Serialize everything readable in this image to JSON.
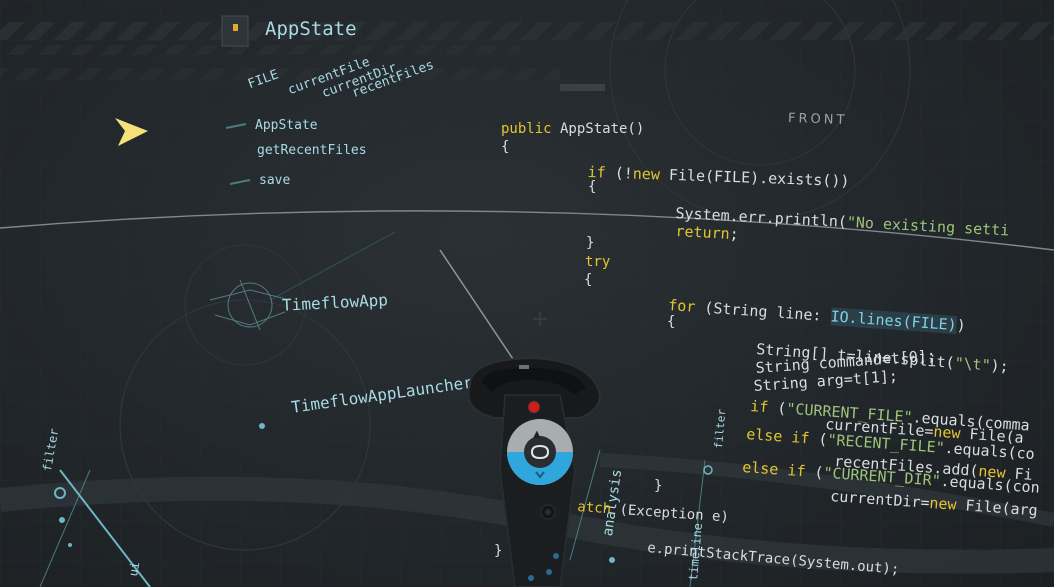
{
  "appstate_node": {
    "title": "AppState",
    "fields": [
      "FILE",
      "currentFile",
      "currentDir",
      "recentFiles"
    ],
    "methods": [
      "AppState",
      "getRecentFiles",
      "save"
    ]
  },
  "front_label": "FRONT",
  "classes": {
    "timeflow_app": "TimeflowApp",
    "timeflow_app_launcher": "TimeflowAppLauncher"
  },
  "floor_labels": {
    "filter_left": "filter",
    "filter_right": "filter",
    "analysis": "analysis",
    "ui": "ui",
    "timeline": "timeline"
  },
  "code": {
    "l1_kw": "public",
    "l1_rest": " AppState()",
    "l2": "{",
    "l3_kw": "if",
    "l3_mid": " (!",
    "l3_kw2": "new",
    "l3_rest": " File(FILE).exists())",
    "l4": "{",
    "l5": "System.err.println(",
    "l5_str": "\"No existing setti",
    "l6_kw": "return",
    "l6_rest": ";",
    "l7": "}",
    "l8_kw": "try",
    "l9": "{",
    "l10_kw": "for",
    "l10_mid": " (String line: ",
    "l10_hl": "IO.lines(FILE)",
    "l10_end": ")",
    "l11": "{",
    "l12_a": "String[] t=line.split(",
    "l12_str": "\"\\t\"",
    "l12_b": ");",
    "l13": "String command=t[0];",
    "l14": "String arg=t[1];",
    "l15_kw": "if",
    "l15_a": " (",
    "l15_str": "\"CURRENT_FILE\"",
    "l15_b": ".equals(comma",
    "l16_a": "currentFile=",
    "l16_kw": "new",
    "l16_b": " File(a",
    "l17_kw": "else if",
    "l17_a": " (",
    "l17_str": "\"RECENT_FILE\"",
    "l17_b": ".equals(co",
    "l18_a": "recentFiles.add(",
    "l18_kw": "new",
    "l18_b": " Fi",
    "l19_kw": "else if",
    "l19_a": " (",
    "l19_str": "\"CURRENT_DIR\"",
    "l19_b": ".equals(con",
    "l20_a": "currentDir=",
    "l20_kw": "new",
    "l20_b": " File(arg",
    "l21": "}",
    "l22_kw": "atch",
    "l22_rest": " (Exception e)",
    "l23": "e.printStackTrace(System.out);",
    "l24": "}"
  },
  "colors": {
    "keyword": "#e3c52f",
    "string": "#9dc47a",
    "text": "#d8dde0",
    "node_label": "#a9dbe6",
    "pointer": "#f5e07a",
    "controller_accent": "#2fa6dc"
  }
}
